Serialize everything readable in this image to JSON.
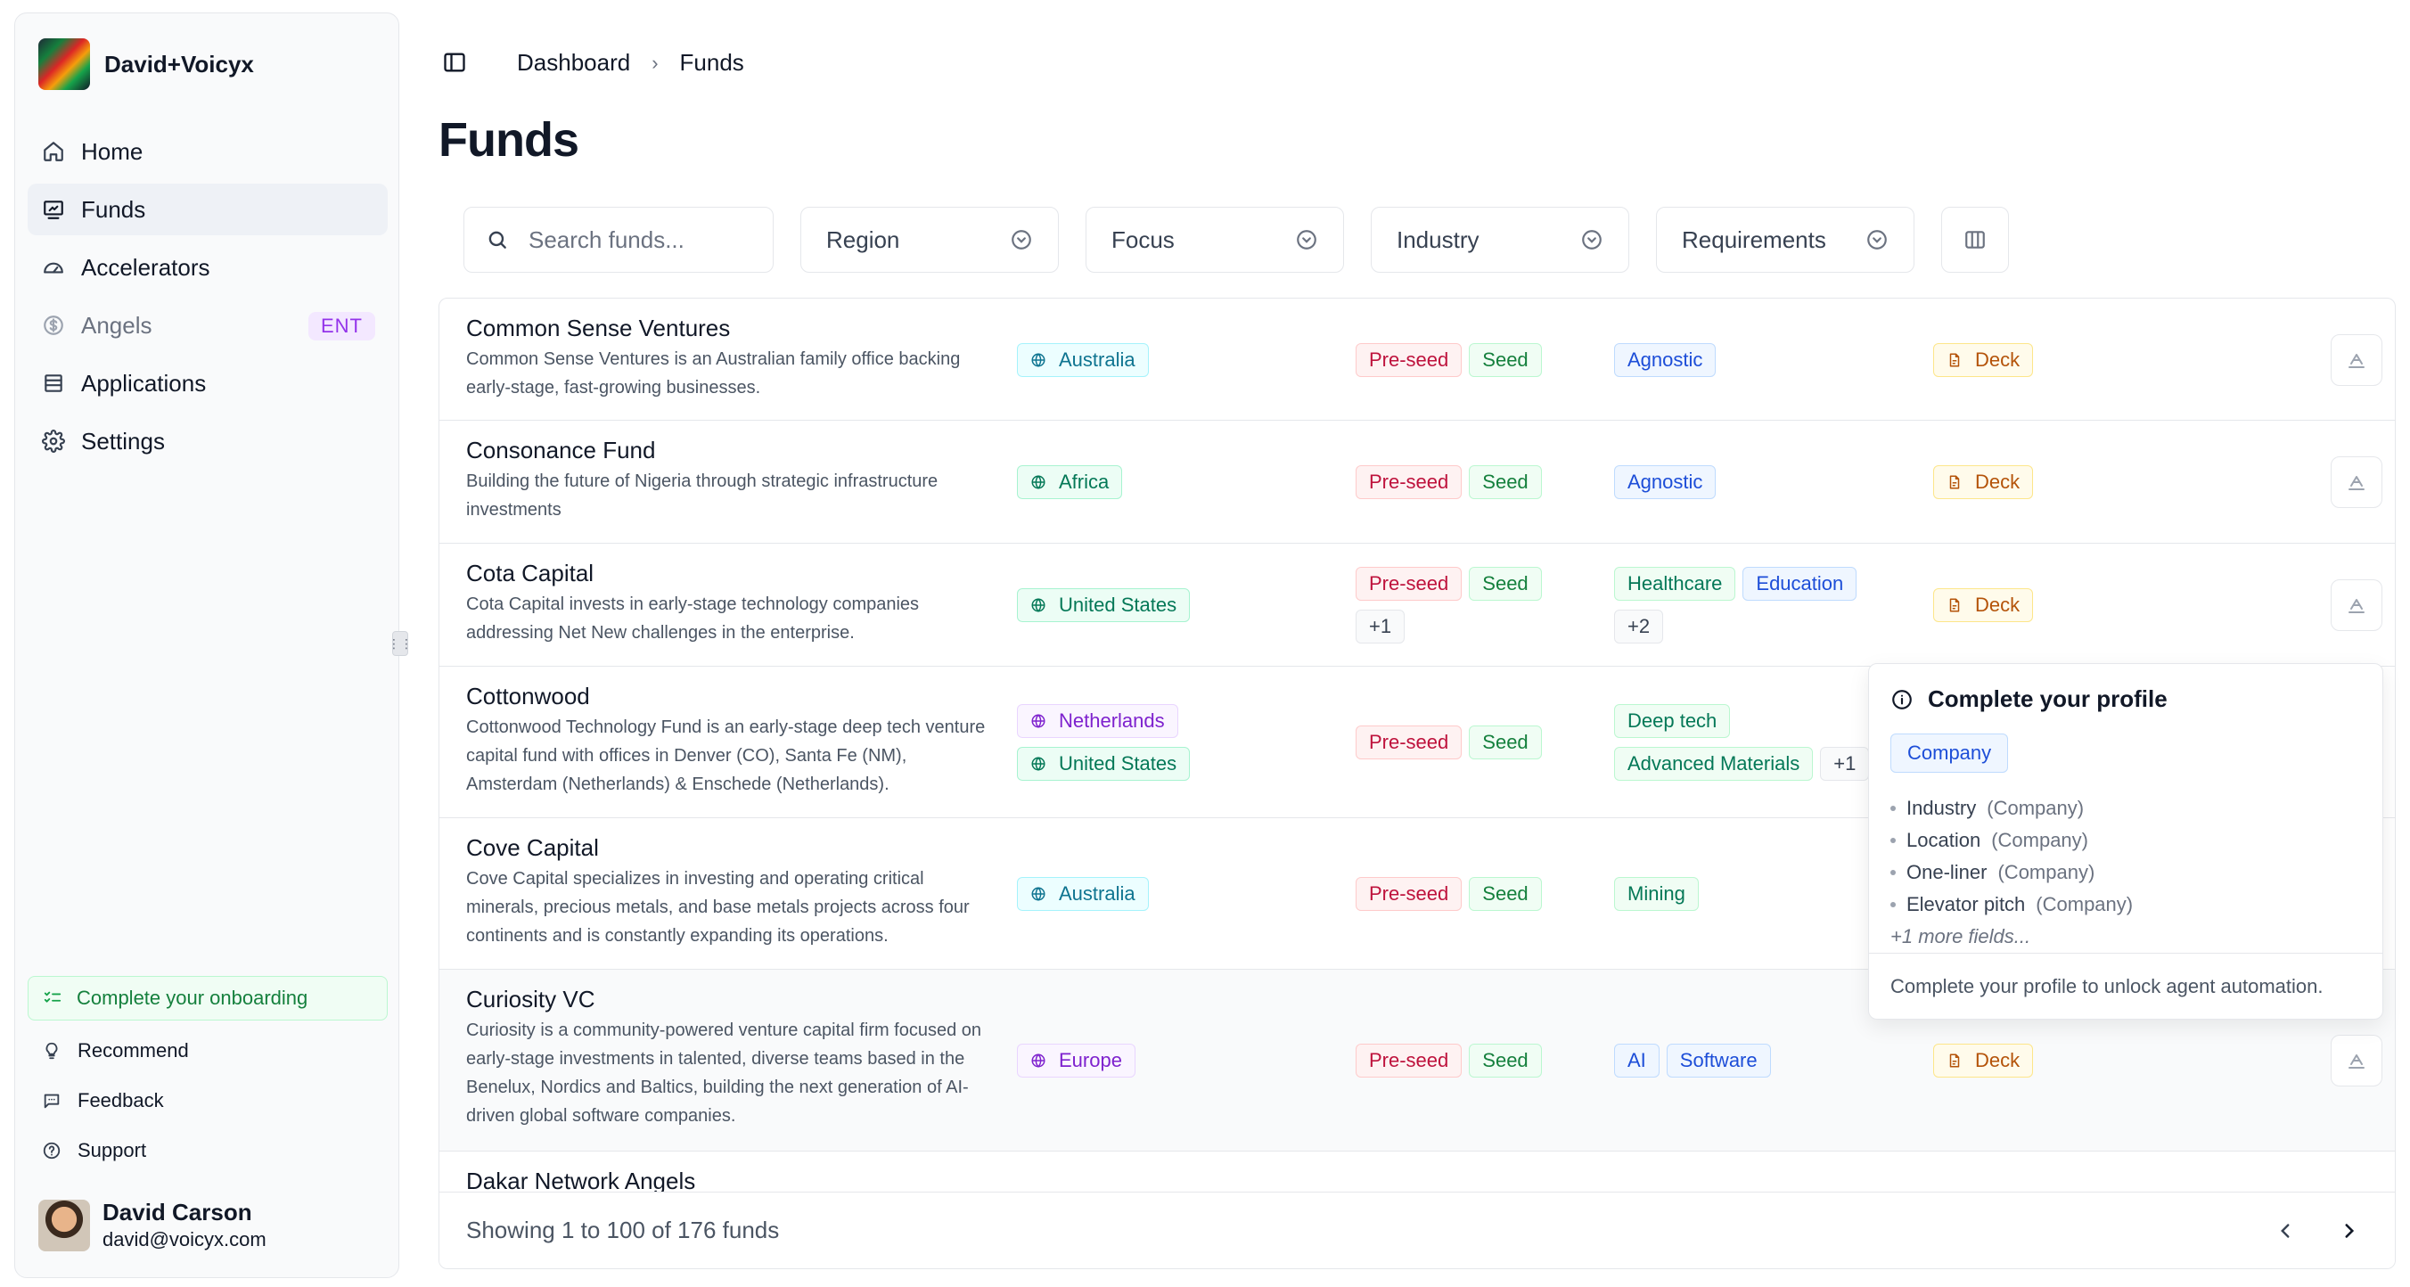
{
  "sidebar": {
    "brand": "David+Voicyx",
    "nav": [
      {
        "label": "Home",
        "icon": "home-icon"
      },
      {
        "label": "Funds",
        "icon": "funds-icon",
        "active": true
      },
      {
        "label": "Accelerators",
        "icon": "accelerator-icon"
      },
      {
        "label": "Angels",
        "icon": "dollar-icon",
        "badge": "ENT"
      },
      {
        "label": "Applications",
        "icon": "applications-icon"
      },
      {
        "label": "Settings",
        "icon": "gear-icon"
      }
    ],
    "onboarding": "Complete your onboarding",
    "secondary": [
      {
        "label": "Recommend",
        "icon": "lightbulb-icon"
      },
      {
        "label": "Feedback",
        "icon": "chat-icon"
      },
      {
        "label": "Support",
        "icon": "help-icon"
      }
    ],
    "user": {
      "name": "David Carson",
      "email": "david@voicyx.com"
    }
  },
  "breadcrumb": {
    "root": "Dashboard",
    "current": "Funds"
  },
  "page_title": "Funds",
  "filters": {
    "search_placeholder": "Search funds...",
    "region": "Region",
    "focus": "Focus",
    "industry": "Industry",
    "requirements": "Requirements"
  },
  "rows": [
    {
      "name": "Common Sense Ventures",
      "desc": "Common Sense Ventures is an Australian family office backing early-stage, fast-growing businesses.",
      "regions": [
        {
          "label": "Australia",
          "style": "cyan"
        }
      ],
      "stages": [
        "Pre-seed",
        "Seed"
      ],
      "industries": [
        {
          "label": "Agnostic",
          "style": "blue"
        }
      ],
      "requirement": "Deck"
    },
    {
      "name": "Consonance Fund",
      "desc": "Building the future of Nigeria through strategic infrastructure investments",
      "regions": [
        {
          "label": "Africa",
          "style": "green"
        }
      ],
      "stages": [
        "Pre-seed",
        "Seed"
      ],
      "industries": [
        {
          "label": "Agnostic",
          "style": "blue"
        }
      ],
      "requirement": "Deck"
    },
    {
      "name": "Cota Capital",
      "desc": "Cota Capital invests in early-stage technology companies addressing Net New challenges in the enterprise.",
      "regions": [
        {
          "label": "United States",
          "style": "green"
        }
      ],
      "stages": [
        "Pre-seed",
        "Seed"
      ],
      "stages_more": "+1",
      "industries": [
        {
          "label": "Healthcare",
          "style": "green"
        },
        {
          "label": "Education",
          "style": "blue"
        }
      ],
      "industries_more": "+2",
      "requirement": "Deck"
    },
    {
      "name": "Cottonwood",
      "desc": "Cottonwood Technology Fund is an early-stage deep tech venture capital fund with offices in Denver (CO), Santa Fe (NM), Amsterdam (Netherlands) & Enschede (Netherlands).",
      "regions": [
        {
          "label": "Netherlands",
          "style": "purple"
        },
        {
          "label": "United States",
          "style": "green"
        }
      ],
      "stages": [
        "Pre-seed",
        "Seed"
      ],
      "industries": [
        {
          "label": "Deep tech",
          "style": "green"
        },
        {
          "label": "Advanced Materials",
          "style": "green"
        }
      ],
      "industries_more": "+1",
      "requirement": ""
    },
    {
      "name": "Cove Capital",
      "desc": "Cove Capital specializes in investing and operating critical minerals, precious metals, and base metals projects across four continents and is constantly expanding its operations.",
      "regions": [
        {
          "label": "Australia",
          "style": "cyan"
        }
      ],
      "stages": [
        "Pre-seed",
        "Seed"
      ],
      "industries": [
        {
          "label": "Mining",
          "style": "green"
        }
      ],
      "requirement": ""
    },
    {
      "name": "Curiosity VC",
      "desc": "Curiosity is a community-powered venture capital firm focused on early-stage investments in talented, diverse teams based in the Benelux, Nordics and Baltics, building the next generation of AI-driven global software companies.",
      "regions": [
        {
          "label": "Europe",
          "style": "purple"
        }
      ],
      "stages": [
        "Pre-seed",
        "Seed"
      ],
      "industries": [
        {
          "label": "AI",
          "style": "blue"
        },
        {
          "label": "Software",
          "style": "blue"
        }
      ],
      "requirement": "Deck"
    },
    {
      "name": "Dakar Network Angels",
      "desc": "",
      "regions": [],
      "stages": [],
      "industries": [],
      "requirement": ""
    }
  ],
  "popover": {
    "title": "Complete your profile",
    "section": "Company",
    "fields": [
      {
        "label": "Industry",
        "scope": "(Company)"
      },
      {
        "label": "Location",
        "scope": "(Company)"
      },
      {
        "label": "One-liner",
        "scope": "(Company)"
      },
      {
        "label": "Elevator pitch",
        "scope": "(Company)"
      }
    ],
    "more": "+1 more fields...",
    "footer": "Complete your profile to unlock agent automation."
  },
  "footer": {
    "showing": "Showing 1 to 100 of 176 funds"
  },
  "colors": {
    "accent": "#111827",
    "preseed": "#be123c",
    "seed": "#15803d",
    "industry_blue": "#1d4ed8",
    "deck": "#b45309",
    "ent": "#9333ea"
  }
}
